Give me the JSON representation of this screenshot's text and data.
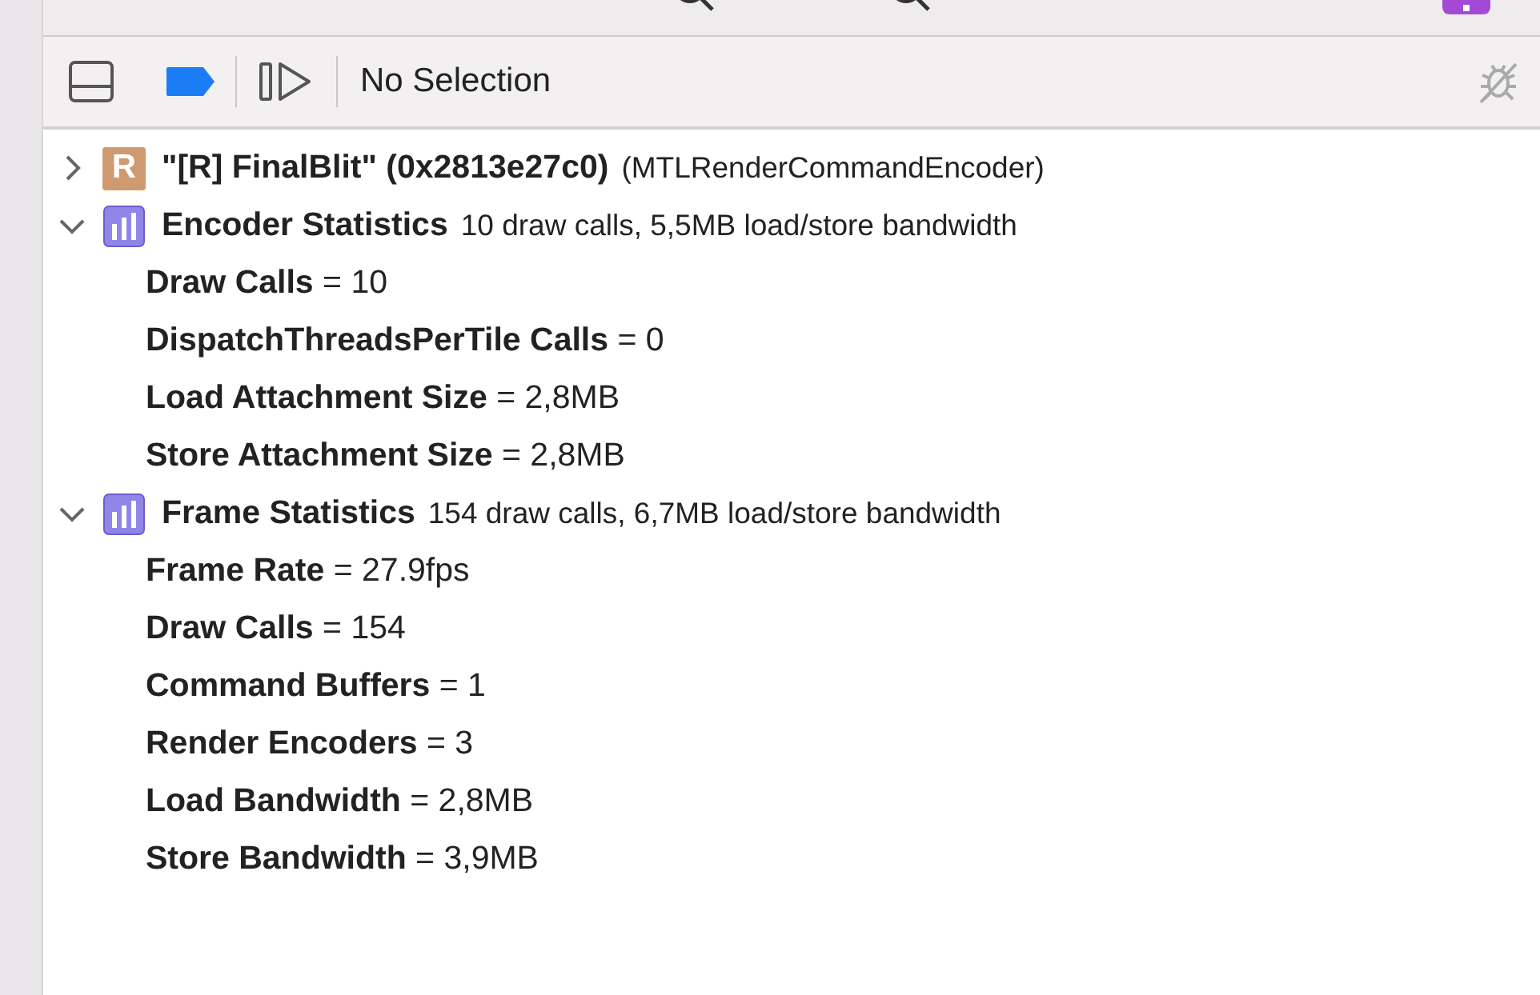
{
  "toolbar": {
    "selection_label": "No Selection",
    "breakpoints_on": true
  },
  "tree": [
    {
      "kind": "encoder",
      "icon_letter": "R",
      "expanded": false,
      "title": "\"[R] FinalBlit\" (0x2813e27c0)",
      "detail": "(MTLRenderCommandEncoder)"
    },
    {
      "kind": "statistics",
      "expanded": true,
      "title": "Encoder Statistics",
      "detail": "10 draw calls, 5,5MB load/store bandwidth",
      "children": [
        {
          "text": "**Draw Calls** = 10"
        },
        {
          "text": "**DispatchThreadsPerTile Calls** = 0"
        },
        {
          "text": "**Load Attachment Size** = 2,8MB"
        },
        {
          "text": "**Store Attachment Size** = 2,8MB"
        }
      ]
    },
    {
      "kind": "statistics",
      "expanded": true,
      "title": "Frame Statistics",
      "detail": "154 draw calls, 6,7MB load/store bandwidth",
      "children": [
        {
          "text": "**Frame Rate** = 27.9fps"
        },
        {
          "text": "**Draw Calls** = 154"
        },
        {
          "text": "**Command Buffers** = 1"
        },
        {
          "text": "**Render Encoders** = 3"
        },
        {
          "text": "**Load Bandwidth** = 2,8MB"
        },
        {
          "text": "**Store Bandwidth** = 3,9MB"
        }
      ]
    }
  ]
}
